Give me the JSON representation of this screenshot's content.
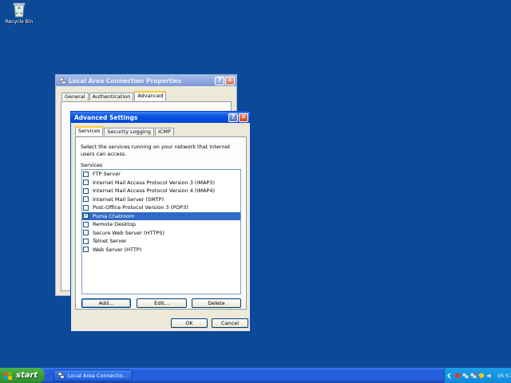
{
  "desktop": {
    "recycle_bin_label": "Recycle Bin"
  },
  "lac_window": {
    "title": "Local Area Connection Properties",
    "help_glyph": "?",
    "close_glyph": "✕",
    "tabs": [
      "General",
      "Authentication",
      "Advanced"
    ],
    "active_tab": "Advanced"
  },
  "advanced_window": {
    "title": "Advanced Settings",
    "help_glyph": "?",
    "close_glyph": "✕",
    "tabs": [
      "Services",
      "Security Logging",
      "ICMP"
    ],
    "active_tab": "Services",
    "description": "Select the services running on your network that Internet users can access.",
    "services_label": "Services",
    "services": [
      {
        "label": "FTP Server",
        "checked": false,
        "selected": false
      },
      {
        "label": "Internet Mail Access Protocol Version 3 (IMAP3)",
        "checked": false,
        "selected": false
      },
      {
        "label": "Internet Mail Access Protocol Version 4 (IMAP4)",
        "checked": false,
        "selected": false
      },
      {
        "label": "Internet Mail Server (SMTP)",
        "checked": false,
        "selected": false
      },
      {
        "label": "Post-Office Protocol Version 3 (POP3)",
        "checked": false,
        "selected": false
      },
      {
        "label": "Puma Chatroom",
        "checked": true,
        "selected": true
      },
      {
        "label": "Remote Desktop",
        "checked": false,
        "selected": false
      },
      {
        "label": "Secure Web Server (HTTPS)",
        "checked": false,
        "selected": false
      },
      {
        "label": "Telnet Server",
        "checked": false,
        "selected": false
      },
      {
        "label": "Web Server (HTTP)",
        "checked": false,
        "selected": false
      }
    ],
    "buttons": {
      "add": "Add...",
      "edit": "Edit...",
      "delete": "Delete",
      "ok": "OK",
      "cancel": "Cancel"
    }
  },
  "taskbar": {
    "start_label": "start",
    "task_button_label": "Local Area Connectio...",
    "clock": "05:57"
  },
  "colors": {
    "desktop": "#0c4a98",
    "selection": "#316ac5",
    "titlebar_active": "#0a52e0"
  }
}
